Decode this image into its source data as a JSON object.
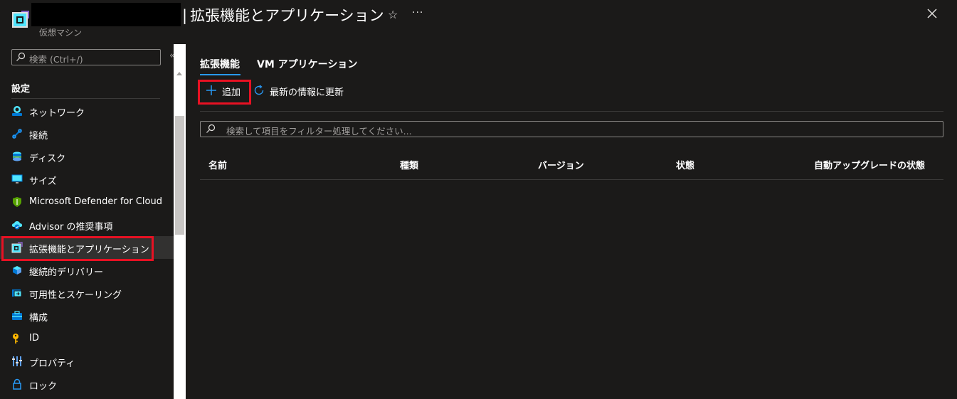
{
  "header": {
    "title_separator": "|",
    "title": "拡張機能とアプリケーション",
    "subtitle": "仮想マシン",
    "favorite_icon": "star-icon",
    "more_icon": "ellipsis-icon",
    "close_icon": "close-icon"
  },
  "sidebar": {
    "search_placeholder": "検索 (Ctrl+/)",
    "collapse_label": "«",
    "group_label": "設定",
    "items": [
      {
        "label": "ネットワーク",
        "icon": "network-icon"
      },
      {
        "label": "接続",
        "icon": "connect-icon"
      },
      {
        "label": "ディスク",
        "icon": "disk-icon"
      },
      {
        "label": "サイズ",
        "icon": "size-icon"
      },
      {
        "label": "Microsoft Defender for Cloud",
        "icon": "defender-shield-icon"
      },
      {
        "label": "Advisor の推奨事項",
        "icon": "advisor-icon"
      },
      {
        "label": "拡張機能とアプリケーション",
        "icon": "extensions-icon",
        "active": true
      },
      {
        "label": "継続的デリバリー",
        "icon": "continuous-delivery-icon"
      },
      {
        "label": "可用性とスケーリング",
        "icon": "availability-icon"
      },
      {
        "label": "構成",
        "icon": "configuration-icon"
      },
      {
        "label": "ID",
        "icon": "identity-key-icon"
      },
      {
        "label": "プロパティ",
        "icon": "properties-icon"
      },
      {
        "label": "ロック",
        "icon": "lock-icon"
      }
    ]
  },
  "main": {
    "tabs": [
      {
        "label": "拡張機能",
        "selected": true
      },
      {
        "label": "VM アプリケーション",
        "selected": false
      }
    ],
    "commands": {
      "add_label": "追加",
      "refresh_label": "最新の情報に更新"
    },
    "filter_placeholder": "検索して項目をフィルター処理してください...",
    "table": {
      "columns": [
        "名前",
        "種類",
        "バージョン",
        "状態",
        "自動アップグレードの状態"
      ],
      "rows": []
    }
  },
  "colors": {
    "background": "#1b1a19",
    "accent": "#2899f5",
    "highlight": "#e81123",
    "active_item": "#323130"
  }
}
